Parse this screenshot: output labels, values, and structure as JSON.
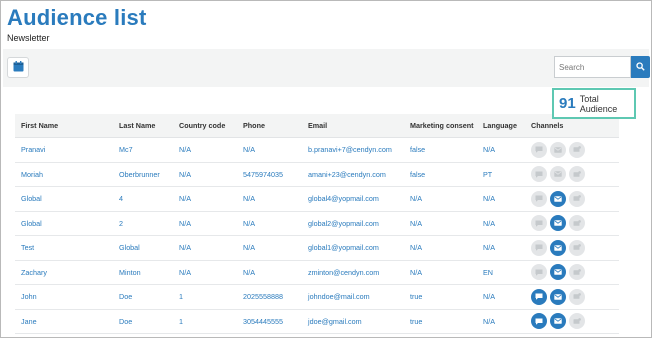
{
  "page": {
    "title": "Audience list",
    "subtitle": "Newsletter"
  },
  "toolbar": {
    "search_placeholder": "Search"
  },
  "total": {
    "count": "91",
    "label": "Total Audience"
  },
  "table": {
    "headers": [
      "First Name",
      "Last Name",
      "Country code",
      "Phone",
      "Email",
      "Marketing consent",
      "Language",
      "Channels"
    ],
    "rows": [
      {
        "first": "Pranavi",
        "last": "Mc7",
        "country": "N/A",
        "phone": "N/A",
        "email": "b.pranavi+7@cendyn.com",
        "consent": "false",
        "language": "N/A",
        "channels": {
          "chat": false,
          "email": false,
          "sms": false
        }
      },
      {
        "first": "Moriah",
        "last": "Oberbrunner",
        "country": "N/A",
        "phone": "5475974035",
        "email": "amani+23@cendyn.com",
        "consent": "false",
        "language": "PT",
        "channels": {
          "chat": false,
          "email": false,
          "sms": false
        }
      },
      {
        "first": "Global",
        "last": "4",
        "country": "N/A",
        "phone": "N/A",
        "email": "global4@yopmail.com",
        "consent": "N/A",
        "language": "N/A",
        "channels": {
          "chat": false,
          "email": true,
          "sms": false
        }
      },
      {
        "first": "Global",
        "last": "2",
        "country": "N/A",
        "phone": "N/A",
        "email": "global2@yopmail.com",
        "consent": "N/A",
        "language": "N/A",
        "channels": {
          "chat": false,
          "email": true,
          "sms": false
        }
      },
      {
        "first": "Test",
        "last": "Global",
        "country": "N/A",
        "phone": "N/A",
        "email": "global1@yopmail.com",
        "consent": "N/A",
        "language": "N/A",
        "channels": {
          "chat": false,
          "email": true,
          "sms": false
        }
      },
      {
        "first": "Zachary",
        "last": "Minton",
        "country": "N/A",
        "phone": "N/A",
        "email": "zminton@cendyn.com",
        "consent": "N/A",
        "language": "EN",
        "channels": {
          "chat": false,
          "email": true,
          "sms": false
        }
      },
      {
        "first": "John",
        "last": "Doe",
        "country": "1",
        "phone": "2025558888",
        "email": "johndoe@mail.com",
        "consent": "true",
        "language": "N/A",
        "channels": {
          "chat": true,
          "email": true,
          "sms": false
        }
      },
      {
        "first": "Jane",
        "last": "Doe",
        "country": "1",
        "phone": "3054445555",
        "email": "jdoe@gmail.com",
        "consent": "true",
        "language": "N/A",
        "channels": {
          "chat": true,
          "email": true,
          "sms": false
        }
      }
    ]
  },
  "icons": {
    "calendar": "calendar-icon",
    "search": "search-icon",
    "chat": "chat-icon",
    "email": "email-icon",
    "sms": "sms-icon"
  },
  "colors": {
    "accent": "#2a7bbd",
    "highlight": "#5ec8b2",
    "inactive": "#e3e5e7"
  }
}
